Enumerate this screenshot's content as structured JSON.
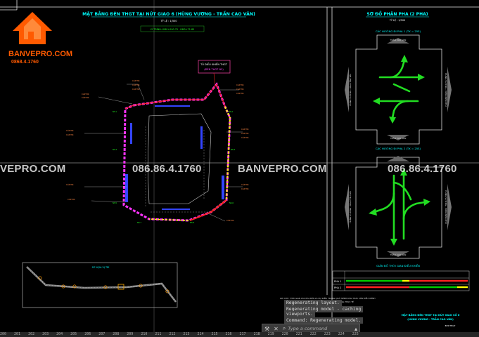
{
  "drawing": {
    "main_title": "MẶT BẰNG ĐÈN THGT TẠI NÚT GIAO 6 (HÙNG VƯƠNG - TRẦN CAO VÂN)",
    "main_scale": "TỶ LỆ : 1/500",
    "coord_label": "LÝ TRÌNH: KM0+000.75 - KM0+71.85",
    "controller_label": "TỦ ĐIỀU KHIỂN THGT",
    "controller_sub": "(ĐÈN THGT N5)",
    "phase_title": "SƠ ĐỒ PHÂN PHA (2 PHA)",
    "phase_scale": "TỶ LỆ : 1/500",
    "phase1_label": "CÁC HƯỚNG ĐI PHA 1 (TX = 25S)",
    "phase2_label": "CÁC HƯỚNG ĐI PHA 2 (TX = 25S)",
    "street_top": "TRẦN CAO VÂN",
    "street_bottom": "TRẦN CAO VÂN",
    "street_left": "HÙNG VƯƠNG - NGUYỄN TRÃI",
    "street_right": "HÙNG VƯƠNG - ĐIỆN BIÊN PHỦ",
    "timing_title": "GIẢN ĐỒ THỜI GIAN ĐIỀU KHIỂN",
    "timing_rows": [
      "PHA 1",
      "PHA 2"
    ],
    "note_line1": "GHI CHÚ: THỜI GIAN CÁC PHA ĐÈN LÀ DỰ KIẾN, TRONG QUÁ TRÌNH KHAI THÁC CẦN ĐIỀU CHỈNH",
    "note_line2": "THỜI GIAN CHU KỲ PHÙ HỢP VỚI TÌNH HÌNH GIAO THÔNG THỰC TẾ",
    "location_title": "SƠ HỌA VỊ TRÍ",
    "titleblock_line1": "MẶT BẰNG ĐÈN THGT TẠI NÚT GIAO SỐ 6",
    "titleblock_line2": "(HÙNG VƯƠNG - TRẦN CAO VÂN)",
    "titleblock_code": "BVP-THGT"
  },
  "branding": {
    "logo_name": "house-logo",
    "logo_text": "BANVEPRO.COM",
    "logo_phone": "0868.4.1760",
    "watermark_site_left": "VEPRO.COM",
    "watermark_phone_1": "086.86.4.1760",
    "watermark_site_mid": "BANVEPRO.COM",
    "watermark_phone_2": "086.86.4.1760",
    "brand_color": "#ff5a00"
  },
  "command_line": {
    "history": [
      "Regenerating layout.",
      "Regenerating model - caching",
      "viewports.",
      "Command: Regenerating model."
    ],
    "placeholder": "Type a command",
    "icons": [
      "wrench-icon",
      "close-icon",
      "search-icon",
      "chevron-up-icon"
    ]
  },
  "statusbar": {
    "ticks": [
      "200",
      "201",
      "202",
      "203",
      "204",
      "205",
      "206",
      "207",
      "208",
      "209",
      "210",
      "211",
      "212",
      "213",
      "214",
      "215",
      "216",
      "217",
      "218",
      "219",
      "220",
      "221",
      "222",
      "223",
      "224",
      "225"
    ]
  },
  "colors": {
    "background": "#000000",
    "frame": "#ffffff",
    "title_cyan": "#00ffff",
    "title_yellow": "#ffff00",
    "curb_pink": "#ff33ff",
    "curb_yellow": "#ffff00",
    "lane_blue": "#3344ff",
    "arrow_green": "#22dd22",
    "cable_red": "#ff2222"
  }
}
